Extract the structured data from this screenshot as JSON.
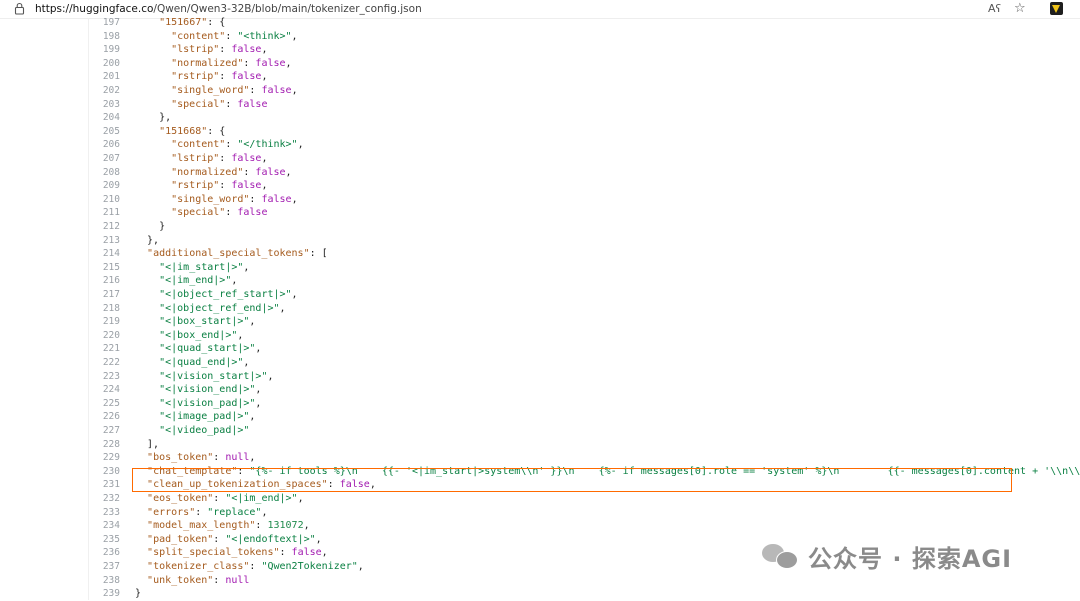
{
  "browser": {
    "url_domain": "https://huggingface.co",
    "url_path": "/Qwen/Qwen3-32B/blob/main/tokenizer_config.json",
    "read_aloud_label": "Aʕ"
  },
  "lines": [
    {
      "n": 197,
      "segs": [
        [
          "p",
          "    "
        ],
        [
          "k",
          "\"151667\""
        ],
        [
          "p",
          ": {"
        ]
      ]
    },
    {
      "n": 198,
      "segs": [
        [
          "p",
          "      "
        ],
        [
          "k",
          "\"content\""
        ],
        [
          "p",
          ": "
        ],
        [
          "s",
          "\"<think>\""
        ],
        [
          "p",
          ","
        ]
      ]
    },
    {
      "n": 199,
      "segs": [
        [
          "p",
          "      "
        ],
        [
          "k",
          "\"lstrip\""
        ],
        [
          "p",
          ": "
        ],
        [
          "b",
          "false"
        ],
        [
          "p",
          ","
        ]
      ]
    },
    {
      "n": 200,
      "segs": [
        [
          "p",
          "      "
        ],
        [
          "k",
          "\"normalized\""
        ],
        [
          "p",
          ": "
        ],
        [
          "b",
          "false"
        ],
        [
          "p",
          ","
        ]
      ]
    },
    {
      "n": 201,
      "segs": [
        [
          "p",
          "      "
        ],
        [
          "k",
          "\"rstrip\""
        ],
        [
          "p",
          ": "
        ],
        [
          "b",
          "false"
        ],
        [
          "p",
          ","
        ]
      ]
    },
    {
      "n": 202,
      "segs": [
        [
          "p",
          "      "
        ],
        [
          "k",
          "\"single_word\""
        ],
        [
          "p",
          ": "
        ],
        [
          "b",
          "false"
        ],
        [
          "p",
          ","
        ]
      ]
    },
    {
      "n": 203,
      "segs": [
        [
          "p",
          "      "
        ],
        [
          "k",
          "\"special\""
        ],
        [
          "p",
          ": "
        ],
        [
          "b",
          "false"
        ]
      ]
    },
    {
      "n": 204,
      "segs": [
        [
          "p",
          "    },"
        ]
      ]
    },
    {
      "n": 205,
      "segs": [
        [
          "p",
          "    "
        ],
        [
          "k",
          "\"151668\""
        ],
        [
          "p",
          ": {"
        ]
      ]
    },
    {
      "n": 206,
      "segs": [
        [
          "p",
          "      "
        ],
        [
          "k",
          "\"content\""
        ],
        [
          "p",
          ": "
        ],
        [
          "s",
          "\"</think>\""
        ],
        [
          "p",
          ","
        ]
      ]
    },
    {
      "n": 207,
      "segs": [
        [
          "p",
          "      "
        ],
        [
          "k",
          "\"lstrip\""
        ],
        [
          "p",
          ": "
        ],
        [
          "b",
          "false"
        ],
        [
          "p",
          ","
        ]
      ]
    },
    {
      "n": 208,
      "segs": [
        [
          "p",
          "      "
        ],
        [
          "k",
          "\"normalized\""
        ],
        [
          "p",
          ": "
        ],
        [
          "b",
          "false"
        ],
        [
          "p",
          ","
        ]
      ]
    },
    {
      "n": 209,
      "segs": [
        [
          "p",
          "      "
        ],
        [
          "k",
          "\"rstrip\""
        ],
        [
          "p",
          ": "
        ],
        [
          "b",
          "false"
        ],
        [
          "p",
          ","
        ]
      ]
    },
    {
      "n": 210,
      "segs": [
        [
          "p",
          "      "
        ],
        [
          "k",
          "\"single_word\""
        ],
        [
          "p",
          ": "
        ],
        [
          "b",
          "false"
        ],
        [
          "p",
          ","
        ]
      ]
    },
    {
      "n": 211,
      "segs": [
        [
          "p",
          "      "
        ],
        [
          "k",
          "\"special\""
        ],
        [
          "p",
          ": "
        ],
        [
          "b",
          "false"
        ]
      ]
    },
    {
      "n": 212,
      "segs": [
        [
          "p",
          "    }"
        ]
      ]
    },
    {
      "n": 213,
      "segs": [
        [
          "p",
          "  },"
        ]
      ]
    },
    {
      "n": 214,
      "segs": [
        [
          "p",
          "  "
        ],
        [
          "k",
          "\"additional_special_tokens\""
        ],
        [
          "p",
          ": ["
        ]
      ]
    },
    {
      "n": 215,
      "segs": [
        [
          "p",
          "    "
        ],
        [
          "s",
          "\"<|im_start|>\""
        ],
        [
          "p",
          ","
        ]
      ]
    },
    {
      "n": 216,
      "segs": [
        [
          "p",
          "    "
        ],
        [
          "s",
          "\"<|im_end|>\""
        ],
        [
          "p",
          ","
        ]
      ]
    },
    {
      "n": 217,
      "segs": [
        [
          "p",
          "    "
        ],
        [
          "s",
          "\"<|object_ref_start|>\""
        ],
        [
          "p",
          ","
        ]
      ]
    },
    {
      "n": 218,
      "segs": [
        [
          "p",
          "    "
        ],
        [
          "s",
          "\"<|object_ref_end|>\""
        ],
        [
          "p",
          ","
        ]
      ]
    },
    {
      "n": 219,
      "segs": [
        [
          "p",
          "    "
        ],
        [
          "s",
          "\"<|box_start|>\""
        ],
        [
          "p",
          ","
        ]
      ]
    },
    {
      "n": 220,
      "segs": [
        [
          "p",
          "    "
        ],
        [
          "s",
          "\"<|box_end|>\""
        ],
        [
          "p",
          ","
        ]
      ]
    },
    {
      "n": 221,
      "segs": [
        [
          "p",
          "    "
        ],
        [
          "s",
          "\"<|quad_start|>\""
        ],
        [
          "p",
          ","
        ]
      ]
    },
    {
      "n": 222,
      "segs": [
        [
          "p",
          "    "
        ],
        [
          "s",
          "\"<|quad_end|>\""
        ],
        [
          "p",
          ","
        ]
      ]
    },
    {
      "n": 223,
      "segs": [
        [
          "p",
          "    "
        ],
        [
          "s",
          "\"<|vision_start|>\""
        ],
        [
          "p",
          ","
        ]
      ]
    },
    {
      "n": 224,
      "segs": [
        [
          "p",
          "    "
        ],
        [
          "s",
          "\"<|vision_end|>\""
        ],
        [
          "p",
          ","
        ]
      ]
    },
    {
      "n": 225,
      "segs": [
        [
          "p",
          "    "
        ],
        [
          "s",
          "\"<|vision_pad|>\""
        ],
        [
          "p",
          ","
        ]
      ]
    },
    {
      "n": 226,
      "segs": [
        [
          "p",
          "    "
        ],
        [
          "s",
          "\"<|image_pad|>\""
        ],
        [
          "p",
          ","
        ]
      ]
    },
    {
      "n": 227,
      "segs": [
        [
          "p",
          "    "
        ],
        [
          "s",
          "\"<|video_pad|>\""
        ]
      ]
    },
    {
      "n": 228,
      "segs": [
        [
          "p",
          "  ],"
        ]
      ]
    },
    {
      "n": 229,
      "segs": [
        [
          "p",
          "  "
        ],
        [
          "k",
          "\"bos_token\""
        ],
        [
          "p",
          ": "
        ],
        [
          "b",
          "null"
        ],
        [
          "p",
          ","
        ]
      ]
    },
    {
      "n": 230,
      "segs": [
        [
          "p",
          "  "
        ],
        [
          "k",
          "\"chat_template\""
        ],
        [
          "p",
          ": "
        ],
        [
          "s",
          "\"{%- if tools %}\\n    {{- '<|im_start|>system\\\\n' }}\\n    {%- if messages[0].role == 'system' %}\\n        {{- messages[0].content + '\\\\n\\\\n' }}\\n"
        ]
      ]
    },
    {
      "n": 231,
      "segs": [
        [
          "p",
          "  "
        ],
        [
          "k",
          "\"clean_up_tokenization_spaces\""
        ],
        [
          "p",
          ": "
        ],
        [
          "b",
          "false"
        ],
        [
          "p",
          ","
        ]
      ]
    },
    {
      "n": 232,
      "segs": [
        [
          "p",
          "  "
        ],
        [
          "k",
          "\"eos_token\""
        ],
        [
          "p",
          ": "
        ],
        [
          "s",
          "\"<|im_end|>\""
        ],
        [
          "p",
          ","
        ]
      ]
    },
    {
      "n": 233,
      "segs": [
        [
          "p",
          "  "
        ],
        [
          "k",
          "\"errors\""
        ],
        [
          "p",
          ": "
        ],
        [
          "s",
          "\"replace\""
        ],
        [
          "p",
          ","
        ]
      ]
    },
    {
      "n": 234,
      "segs": [
        [
          "p",
          "  "
        ],
        [
          "k",
          "\"model_max_length\""
        ],
        [
          "p",
          ": "
        ],
        [
          "n",
          "131072"
        ],
        [
          "p",
          ","
        ]
      ]
    },
    {
      "n": 235,
      "segs": [
        [
          "p",
          "  "
        ],
        [
          "k",
          "\"pad_token\""
        ],
        [
          "p",
          ": "
        ],
        [
          "s",
          "\"<|endoftext|>\""
        ],
        [
          "p",
          ","
        ]
      ]
    },
    {
      "n": 236,
      "segs": [
        [
          "p",
          "  "
        ],
        [
          "k",
          "\"split_special_tokens\""
        ],
        [
          "p",
          ": "
        ],
        [
          "b",
          "false"
        ],
        [
          "p",
          ","
        ]
      ]
    },
    {
      "n": 237,
      "segs": [
        [
          "p",
          "  "
        ],
        [
          "k",
          "\"tokenizer_class\""
        ],
        [
          "p",
          ": "
        ],
        [
          "s",
          "\"Qwen2Tokenizer\""
        ],
        [
          "p",
          ","
        ]
      ]
    },
    {
      "n": 238,
      "segs": [
        [
          "p",
          "  "
        ],
        [
          "k",
          "\"unk_token\""
        ],
        [
          "p",
          ": "
        ],
        [
          "b",
          "null"
        ]
      ]
    },
    {
      "n": 239,
      "segs": [
        [
          "p",
          "}"
        ]
      ]
    }
  ],
  "watermark": {
    "text": "公众号 · 探索AGI",
    "icon": "wechat-icon"
  },
  "colors": {
    "key": "#a55b1e",
    "string": "#0b8043",
    "boolean": "#a21bb0",
    "number": "#1f8a4c",
    "highlight_box": "#ff6a00"
  }
}
